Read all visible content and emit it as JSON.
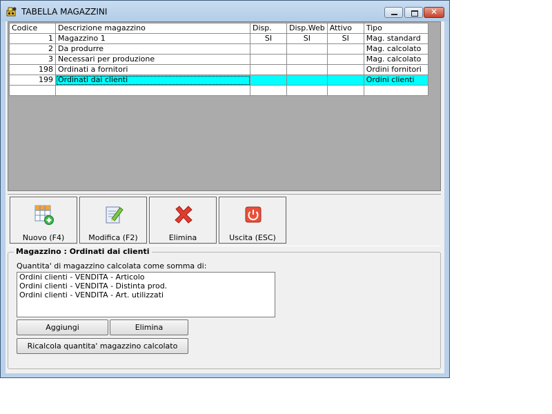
{
  "window": {
    "title": "TABELLA MAGAZZINI"
  },
  "grid": {
    "columns": [
      "Codice",
      "Descrizione magazzino",
      "Disp.",
      "Disp.Web",
      "Attivo",
      "Tipo"
    ],
    "rows": [
      {
        "codice": "1",
        "descrizione": "Magazzino 1",
        "disp": "SI",
        "disp_web": "SI",
        "attivo": "SI",
        "tipo": "Mag. standard"
      },
      {
        "codice": "2",
        "descrizione": "Da produrre",
        "disp": "",
        "disp_web": "",
        "attivo": "",
        "tipo": "Mag. calcolato"
      },
      {
        "codice": "3",
        "descrizione": "Necessari per produzione",
        "disp": "",
        "disp_web": "",
        "attivo": "",
        "tipo": "Mag. calcolato"
      },
      {
        "codice": "198",
        "descrizione": "Ordinati a fornitori",
        "disp": "",
        "disp_web": "",
        "attivo": "",
        "tipo": "Ordini fornitori"
      },
      {
        "codice": "199",
        "descrizione": "Ordinati dai clienti",
        "disp": "",
        "disp_web": "",
        "attivo": "",
        "tipo": "Ordini clienti"
      }
    ],
    "selected_index": 4,
    "highlight_color": "#00ffff"
  },
  "toolbar": {
    "nuovo_label": "Nuovo (F4)",
    "modifica_label": "Modifica (F2)",
    "elimina_label": "Elimina",
    "uscita_label": "Uscita (ESC)",
    "icons": {
      "nuovo": "grid-add-icon",
      "modifica": "edit-document-icon",
      "elimina": "red-x-icon",
      "uscita": "power-icon"
    }
  },
  "detail": {
    "title": "Magazzino : Ordinati dai clienti",
    "subtitle": "Quantita' di magazzino calcolata come somma di:",
    "items": [
      "Ordini clienti - VENDITA - Articolo",
      "Ordini clienti - VENDITA - Distinta prod.",
      "Ordini clienti - VENDITA - Art. utilizzati"
    ],
    "add_label": "Aggiungi",
    "delete_label": "Elimina",
    "recalc_label": "Ricalcola quantita' magazzino calcolato"
  }
}
